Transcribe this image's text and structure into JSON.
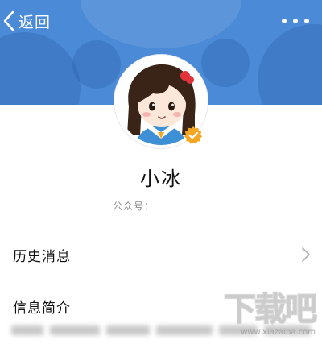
{
  "header": {
    "back_label": "返回",
    "back_icon": "chevron-left-icon",
    "more_icon": "more-dots-icon",
    "background_color": "#4a8ad6"
  },
  "profile": {
    "avatar": "girl-avatar",
    "verified_icon": "verified-badge-icon",
    "verified_color": "#f5a623",
    "name": "小冰",
    "account_label": "公众号："
  },
  "menu": {
    "history_label": "历史消息",
    "history_icon": "chevron-right-icon",
    "intro_title": "信息简介"
  },
  "watermark": {
    "text": "下载吧",
    "url": "www.xiazaiba.com"
  }
}
